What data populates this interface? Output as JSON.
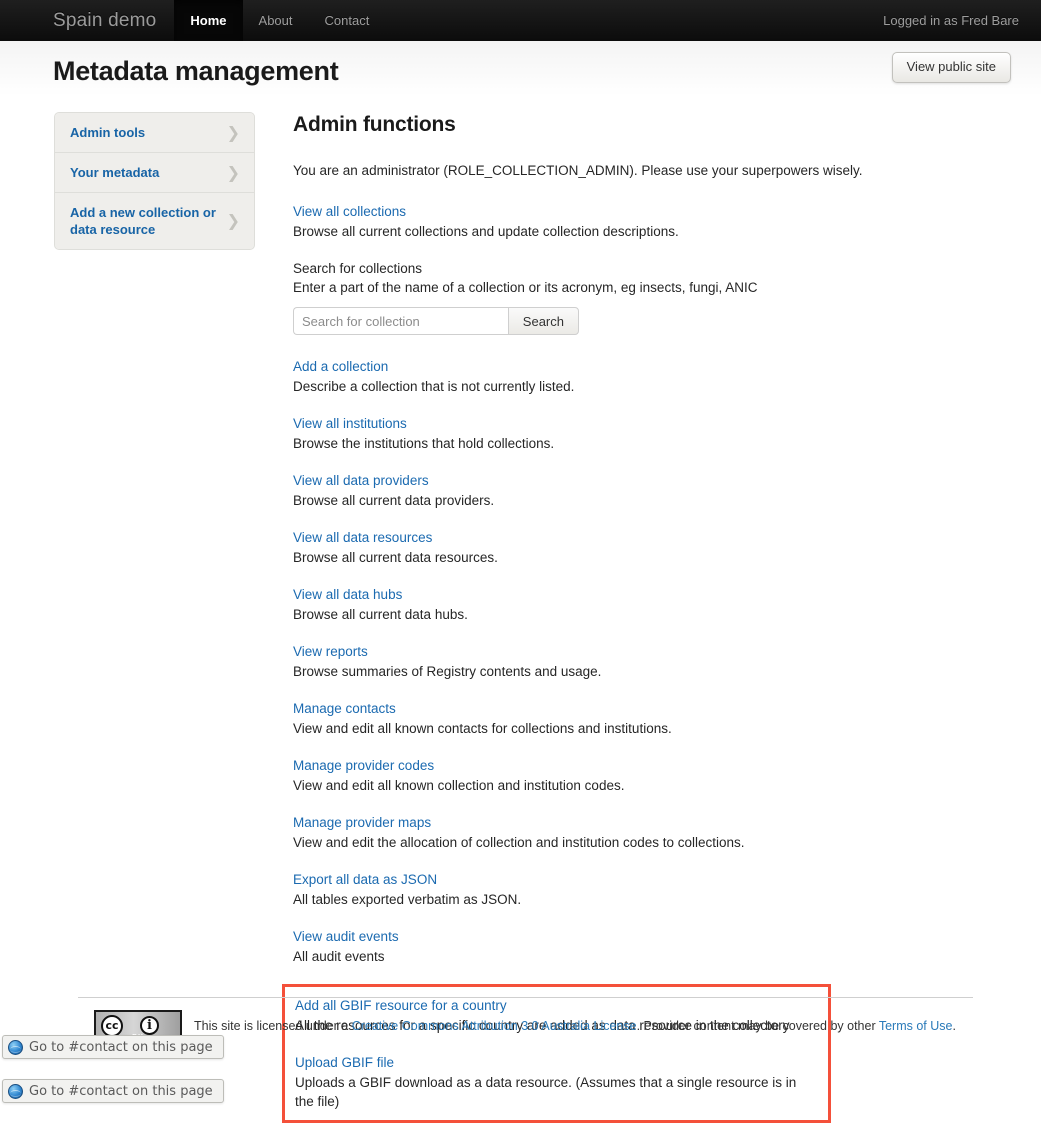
{
  "navbar": {
    "brand": "Spain demo",
    "links": [
      {
        "label": "Home",
        "active": true
      },
      {
        "label": "About",
        "active": false
      },
      {
        "label": "Contact",
        "active": false
      }
    ],
    "user_status": "Logged in as Fred Bare"
  },
  "header": {
    "title": "Metadata management",
    "view_public_site_label": "View public site"
  },
  "sidebar": {
    "items": [
      {
        "label": "Admin tools",
        "icon": "chevron-right-icon"
      },
      {
        "label": "Your metadata",
        "icon": "chevron-right-icon"
      },
      {
        "label": "Add a new collection or data resource",
        "icon": "chevron-right-icon"
      }
    ]
  },
  "main": {
    "heading": "Admin functions",
    "intro": "You are an administrator (ROLE_COLLECTION_ADMIN). Please use your superpowers wisely.",
    "view_all_collections": {
      "link": "View all collections",
      "desc": "Browse all current collections and update collection descriptions."
    },
    "search": {
      "title": "Search for collections",
      "hint": "Enter a part of the name of a collection or its acronym, eg insects, fungi, ANIC",
      "placeholder": "Search for collection",
      "value": "",
      "button_label": "Search"
    },
    "functions": [
      {
        "link": "Add a collection",
        "desc": "Describe a collection that is not currently listed."
      },
      {
        "link": "View all institutions",
        "desc": "Browse the institutions that hold collections."
      },
      {
        "link": "View all data providers",
        "desc": "Browse all current data providers."
      },
      {
        "link": "View all data resources",
        "desc": "Browse all current data resources."
      },
      {
        "link": "View all data hubs",
        "desc": "Browse all current data hubs."
      },
      {
        "link": "View reports",
        "desc": "Browse summaries of Registry contents and usage."
      },
      {
        "link": "Manage contacts",
        "desc": "View and edit all known contacts for collections and institutions."
      },
      {
        "link": "Manage provider codes",
        "desc": "View and edit all known collection and institution codes."
      },
      {
        "link": "Manage provider maps",
        "desc": "View and edit the allocation of collection and institution codes to collections."
      },
      {
        "link": "Export all data as JSON",
        "desc": "All tables exported verbatim as JSON."
      },
      {
        "link": "View audit events",
        "desc": "All audit events"
      }
    ],
    "gbif_group": {
      "highlight_color": "#f4503a",
      "items": [
        {
          "link": "Add all GBIF resource for a country",
          "desc": "All the resources for a specific country are added as data resource in the collectory"
        },
        {
          "link": "Upload GBIF file",
          "desc": "Uploads a GBIF download as a data resource. (Assumes that a single resource is in the file)"
        }
      ]
    }
  },
  "footer": {
    "cc_badge": {
      "cc_glyph": "cc",
      "by_glyph": "i",
      "by_label": "BY"
    },
    "text_before": "This site is licensed under a ",
    "license_link": "Creative Commons Attribution 3.0 Australia License",
    "text_middle": ". Provider content may be covered by other ",
    "terms_link": "Terms of Use",
    "text_after": "."
  },
  "status_chips": [
    {
      "label": "Go to #contact on this page",
      "icon": "globe-icon"
    },
    {
      "label": "Go to #contact on this page",
      "icon": "globe-icon"
    }
  ]
}
